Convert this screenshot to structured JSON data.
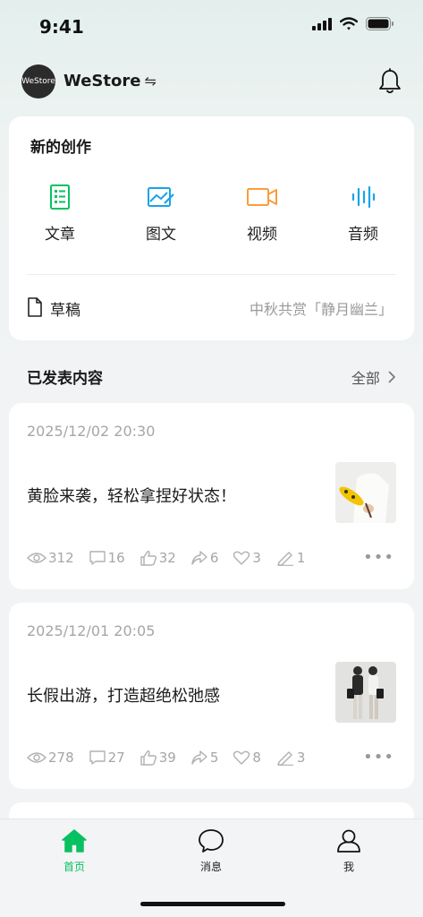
{
  "status_bar": {
    "time": "9:41"
  },
  "header": {
    "avatar_text": "WeStore",
    "store_name": "WeStore",
    "switch_symbol": "⇋"
  },
  "create": {
    "title": "新的创作",
    "types": [
      {
        "label": "文章",
        "icon": "article-icon",
        "color": "#07c160"
      },
      {
        "label": "图文",
        "icon": "image-text-icon",
        "color": "#1aa3e8"
      },
      {
        "label": "视频",
        "icon": "video-icon",
        "color": "#fa9d3b"
      },
      {
        "label": "音频",
        "icon": "audio-icon",
        "color": "#1aa3e8"
      }
    ],
    "draft_label": "草稿",
    "draft_title": "中秋共赏「静月幽兰」"
  },
  "published": {
    "title": "已发表内容",
    "see_all": "全部",
    "posts": [
      {
        "date": "2025/12/02 20:30",
        "title": "黄脸来袭，轻松拿捏好状态！",
        "views": "312",
        "comments": "16",
        "likes": "32",
        "shares": "6",
        "favorites": "3",
        "edits": "1"
      },
      {
        "date": "2025/12/01 20:05",
        "title": "长假出游，打造超绝松弛感",
        "views": "278",
        "comments": "27",
        "likes": "39",
        "shares": "5",
        "favorites": "8",
        "edits": "3"
      }
    ]
  },
  "tabbar": {
    "tabs": [
      {
        "label": "首页",
        "icon": "home-icon",
        "active": true
      },
      {
        "label": "消息",
        "icon": "message-icon",
        "active": false
      },
      {
        "label": "我",
        "icon": "profile-icon",
        "active": false
      }
    ],
    "active_color": "#07c160"
  }
}
